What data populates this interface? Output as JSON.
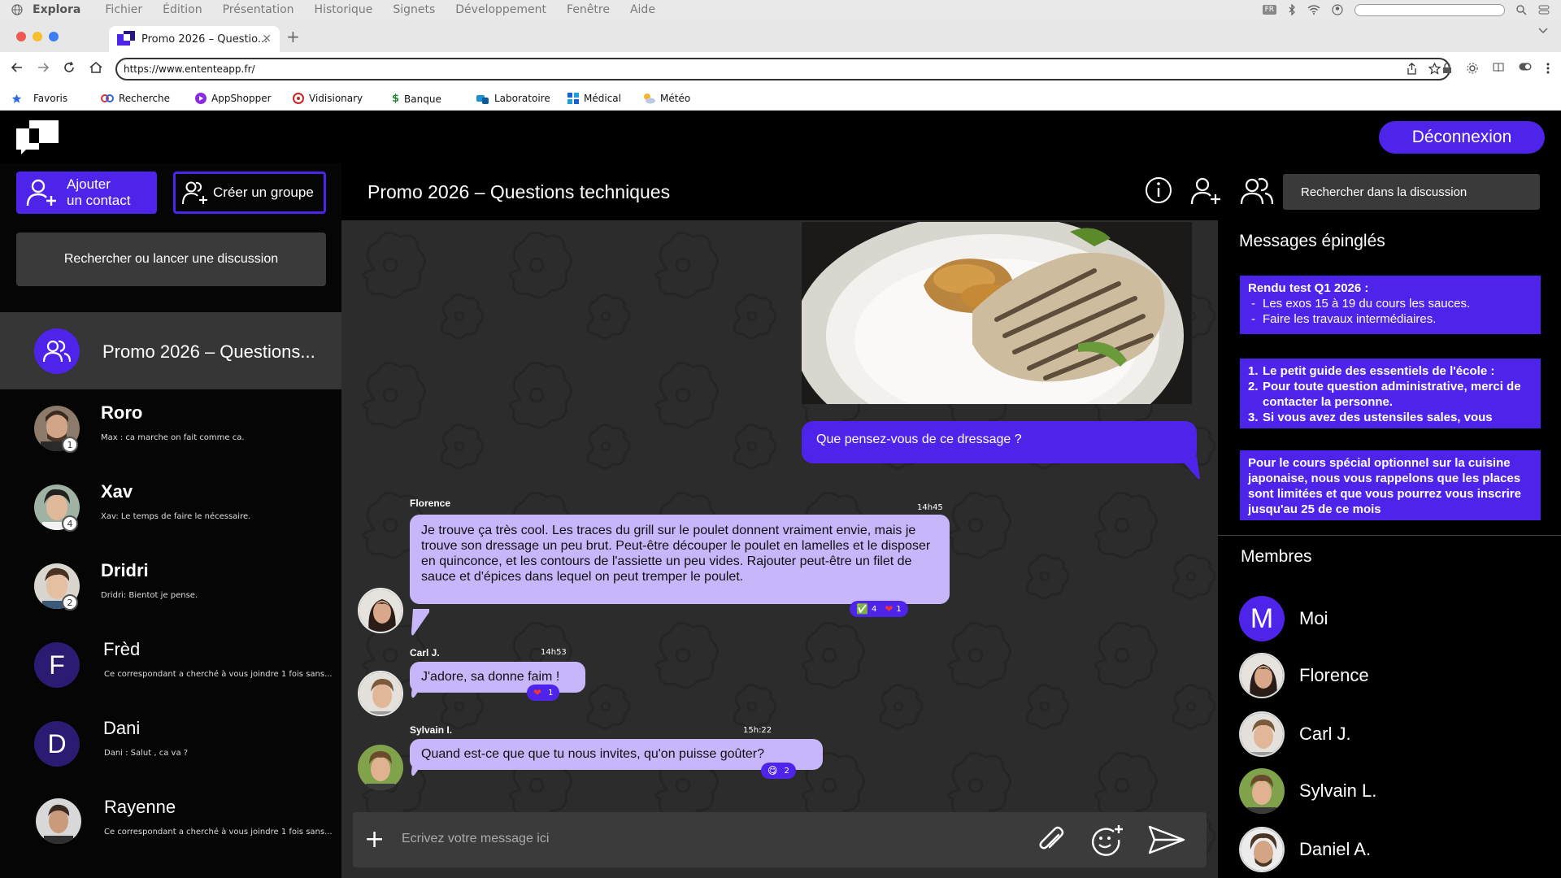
{
  "os_menu": {
    "app": "Explora",
    "items": [
      "Fichier",
      "Édition",
      "Présentation",
      "Historique",
      "Signets",
      "Développement",
      "Fenêtre",
      "Aide"
    ],
    "flag_label": "FR"
  },
  "browser": {
    "tab_title": "Promo 2026 – Questio...",
    "url": "https://www.ententeapp.fr/",
    "bookmarks": [
      "Favoris",
      "Recherche",
      "AppShopper",
      "Vidisionary",
      "Banque",
      "Laboratoire",
      "Médical",
      "Météo"
    ]
  },
  "app": {
    "logout_label": "Déconnexion",
    "add_contact_line1": "Ajouter",
    "add_contact_line2": "un contact",
    "create_group_label": "Créer un groupe",
    "sidebar_search_placeholder": "Rechercher ou lancer une discussion",
    "conversations": [
      {
        "name": "Promo 2026 – Questions...",
        "preview": "",
        "badge": "",
        "active": true
      },
      {
        "name": "Roro",
        "preview": "Max : ca marche on fait comme ca.",
        "badge": "1"
      },
      {
        "name": "Xav",
        "preview": "Xav: Le temps de faire le nécessaire.",
        "badge": "4"
      },
      {
        "name": "Dridri",
        "preview": "Dridri: Bientot je pense.",
        "badge": "2"
      },
      {
        "name": "Frèd",
        "preview": "Ce correspondant a cherché à vous joindre 1 fois sans...",
        "badge": "",
        "letter": "F"
      },
      {
        "name": "Dani",
        "preview": "Dani : Salut , ca va ?",
        "badge": "",
        "letter": "D"
      },
      {
        "name": "Rayenne",
        "preview": "Ce correspondant a cherché à vous joindre 1 fois sans...",
        "badge": ""
      }
    ],
    "chat": {
      "title": "Promo 2026 – Questions techniques",
      "search_placeholder": "Rechercher dans la discussion",
      "my_message": "Que pensez-vous de ce dressage ?",
      "messages": [
        {
          "author": "Florence",
          "time": "14h45",
          "text": "Je trouve ça très cool. Les traces du grill sur le poulet donnent vraiment envie, mais je trouve son dressage un peu brut. Peut-être découper le poulet en lamelles et le disposer en quinconce, et les contours de l'assiette un peu vides. Rajouter peut-être un filet de sauce et d'épices dans lequel on peut tremper le poulet.",
          "reactions": [
            {
              "emoji": "✅",
              "count": "4"
            },
            {
              "emoji": "❤",
              "count": "1"
            }
          ]
        },
        {
          "author": "Carl J.",
          "time": "14h53",
          "text": "J'adore, sa donne faim !",
          "reactions": [
            {
              "emoji": "❤",
              "count": "1"
            }
          ]
        },
        {
          "author": "Sylvain I.",
          "time": "15h:22",
          "text": "Quand est-ce que que tu nous invites, qu'on puisse goûter?",
          "reactions": [
            {
              "emoji": "😋",
              "count": "2"
            }
          ]
        }
      ],
      "composer_placeholder": "Ecrivez votre message ici"
    },
    "pinned": {
      "title": "Messages épinglés",
      "items": [
        {
          "heading": "Rendu test Q1 2026 :",
          "bullets": [
            "Les exos 15 à 19 du cours les sauces.",
            "Faire les travaux intermédiaires."
          ]
        },
        {
          "numbered": [
            "Le petit guide des essentiels de l'école :",
            "Pour toute question administrative, merci de contacter la personne.",
            "Si vous avez des ustensiles sales, vous"
          ]
        },
        {
          "text": "Pour le cours spécial optionnel sur la cuisine japonaise, nous vous rappelons que les places sont limitées et que vous pourrez vous inscrire jusqu'au 25 de ce mois"
        }
      ]
    },
    "members": {
      "title": "Membres",
      "list": [
        "Moi",
        "Florence",
        "Carl J.",
        "Sylvain L.",
        "Daniel A."
      ],
      "moi_letter": "M"
    },
    "colors": {
      "accent": "#4f24ea",
      "bubble": "#c7b6fa",
      "background": "#000000"
    }
  }
}
